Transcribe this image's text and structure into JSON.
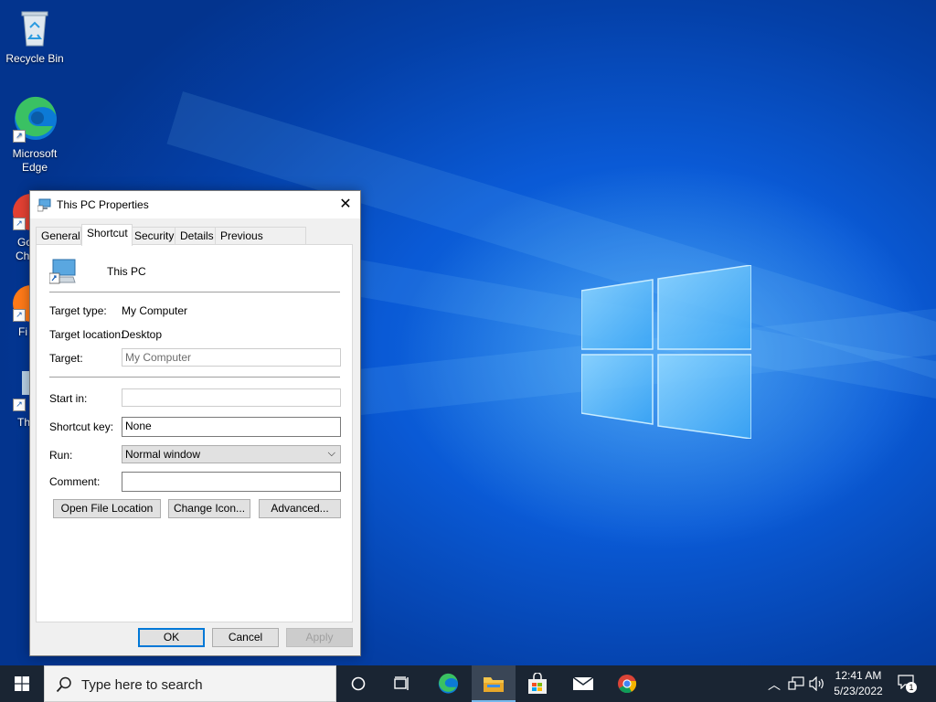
{
  "desktop": {
    "icons": [
      {
        "label": "Recycle Bin"
      },
      {
        "label": "Microsoft Edge"
      }
    ],
    "partial_labels": [
      "Go",
      "Ch",
      "Fi",
      "Th"
    ]
  },
  "dialog": {
    "title": "This PC Properties",
    "tabs": [
      "General",
      "Shortcut",
      "Security",
      "Details",
      "Previous Versions"
    ],
    "active_tab": "Shortcut",
    "shortcut_name": "This PC",
    "target_type_label": "Target type:",
    "target_type_value": "My Computer",
    "target_location_label": "Target location:",
    "target_location_value": "Desktop",
    "target_label": "Target:",
    "target_value": "My Computer",
    "start_in_label": "Start in:",
    "start_in_value": "",
    "shortcut_key_label": "Shortcut key:",
    "shortcut_key_value": "None",
    "run_label": "Run:",
    "run_value": "Normal window",
    "comment_label": "Comment:",
    "comment_value": "",
    "open_file_location": "Open File Location",
    "change_icon": "Change Icon...",
    "advanced": "Advanced...",
    "ok": "OK",
    "cancel": "Cancel",
    "apply": "Apply"
  },
  "taskbar": {
    "search_placeholder": "Type here to search",
    "time": "12:41 AM",
    "date": "5/23/2022",
    "notification_count": "1"
  }
}
